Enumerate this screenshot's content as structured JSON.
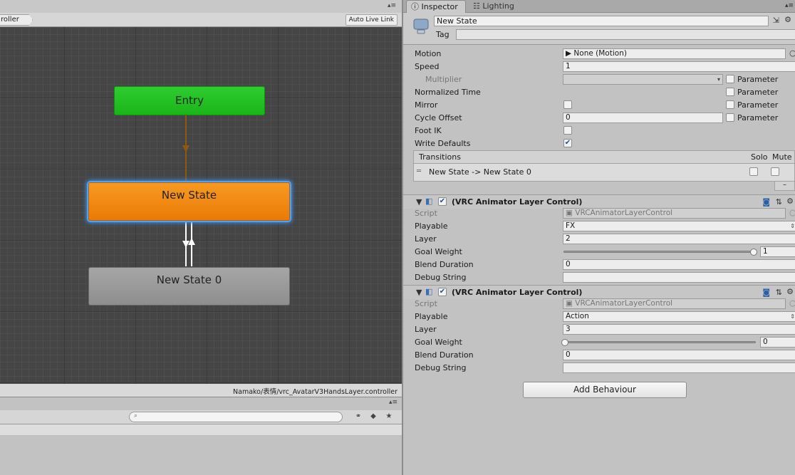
{
  "animator": {
    "breadcrumb": "roller",
    "auto_live_link": "Auto Live Link",
    "controller_path": "Namako/表情/vrc_AvatarV3HandsLayer.controller",
    "nodes": {
      "entry": "Entry",
      "state": "New State",
      "state0": "New State 0"
    },
    "colors": {
      "entry": "#1fbf1f",
      "state": "#f08410",
      "state0": "#9a9a9a",
      "selection": "#3f8fe6",
      "transition_entry": "#8a5a12",
      "transition_states": "#ffffff"
    }
  },
  "project": {
    "search_placeholder": "",
    "icons": [
      "search-icon",
      "filter-icon",
      "tag-icon",
      "star-icon"
    ]
  },
  "inspector": {
    "tabs": {
      "inspector": "Inspector",
      "lighting": "Lighting"
    },
    "object_name": "New State",
    "tag_label": "Tag",
    "motion_label": "Motion",
    "motion_value": "None (Motion)",
    "speed_label": "Speed",
    "speed_value": "1",
    "multiplier_label": "Multiplier",
    "normalized_time_label": "Normalized Time",
    "mirror_label": "Mirror",
    "cycle_offset_label": "Cycle Offset",
    "cycle_offset_value": "0",
    "foot_ik_label": "Foot IK",
    "write_defaults_label": "Write Defaults",
    "parameter_label": "Parameter",
    "write_defaults_checked": "✔",
    "transitions": {
      "header": "Transitions",
      "solo": "Solo",
      "mute": "Mute",
      "item": "New State -> New State 0",
      "minus": "–"
    },
    "components": [
      {
        "title": "(VRC Animator Layer Control)",
        "enabled_mark": "✔",
        "script_label": "Script",
        "script_value": "VRCAnimatorLayerControl",
        "playable_label": "Playable",
        "playable_value": "FX",
        "layer_label": "Layer",
        "layer_value": "2",
        "goal_weight_label": "Goal Weight",
        "goal_weight_value": "1",
        "blend_duration_label": "Blend Duration",
        "blend_duration_value": "0",
        "debug_string_label": "Debug String",
        "debug_string_value": ""
      },
      {
        "title": "(VRC Animator Layer Control)",
        "enabled_mark": "✔",
        "script_label": "Script",
        "script_value": "VRCAnimatorLayerControl",
        "playable_label": "Playable",
        "playable_value": "Action",
        "layer_label": "Layer",
        "layer_value": "3",
        "goal_weight_label": "Goal Weight",
        "goal_weight_value": "0",
        "blend_duration_label": "Blend Duration",
        "blend_duration_value": "0",
        "debug_string_label": "Debug String",
        "debug_string_value": ""
      }
    ],
    "add_behaviour": "Add Behaviour"
  }
}
